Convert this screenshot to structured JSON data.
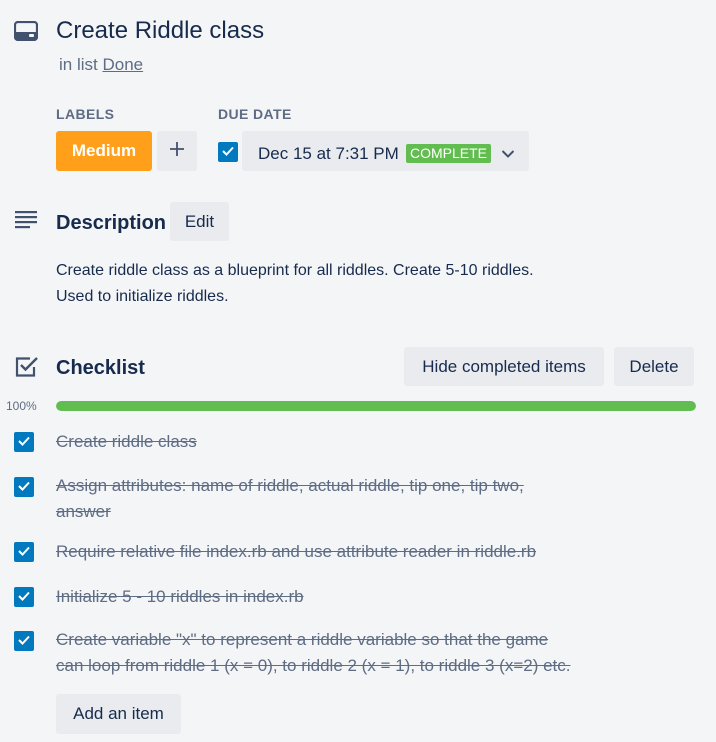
{
  "card": {
    "title": "Create Riddle class",
    "list_prefix": "in list",
    "list_name": "Done"
  },
  "labels": {
    "heading": "LABELS",
    "items": [
      {
        "name": "Medium",
        "color": "#ff9f1a"
      }
    ],
    "add_icon": "plus-icon"
  },
  "due_date": {
    "heading": "DUE DATE",
    "value": "Dec 15 at 7:31 PM",
    "status": "COMPLETE",
    "status_color": "#61bd4f",
    "checked": true
  },
  "description": {
    "heading": "Description",
    "edit_label": "Edit",
    "line1": "Create riddle class as a blueprint for all riddles. Create 5-10 riddles.",
    "line2": "Used to initialize riddles."
  },
  "checklist": {
    "heading": "Checklist",
    "hide_label": "Hide completed items",
    "delete_label": "Delete",
    "progress_label": "100%",
    "progress": 1.0,
    "progress_color": "#61bd4f",
    "items": [
      {
        "line1": "Create riddle class",
        "line2": "",
        "checked": true
      },
      {
        "line1": "Assign attributes: name of riddle, actual riddle, tip one, tip two,",
        "line2": "answer",
        "checked": true
      },
      {
        "line1": "Require relative file index.rb and use attribute reader in riddle.rb",
        "line2": "",
        "checked": true
      },
      {
        "line1": "Initialize 5 - 10 riddles in index.rb",
        "line2": "",
        "checked": true
      },
      {
        "line1": "Create variable \"x\" to represent a riddle variable so that the game",
        "line2": "can loop from riddle 1 (x = 0), to riddle 2 (x = 1), to riddle 3 (x=2) etc.",
        "checked": true
      }
    ],
    "add_item_label": "Add an item"
  },
  "icons": {
    "card": "card-icon",
    "description": "description-icon",
    "checklist": "checklist-icon",
    "chevron": "chevron-down-icon",
    "check": "check-icon"
  },
  "colors": {
    "accent_blue": "#0079bf",
    "background": "#f4f5f7"
  }
}
